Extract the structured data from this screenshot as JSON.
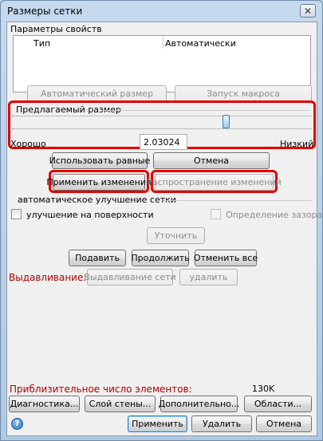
{
  "window": {
    "title": "Размеры сетки",
    "close_glyph": "✕"
  },
  "properties": {
    "group_label": "Параметры свойств",
    "columns": [
      "Тип",
      "Автоматически"
    ]
  },
  "buttons_row1": {
    "auto_size": "Автоматический размер",
    "run_macro": "Запуск макроса"
  },
  "suggested_size": {
    "label": "Предлагаемый размер",
    "left_label": "Хорошо",
    "right_label": "Низкий",
    "value": "2.03024",
    "slider_position": 0.72
  },
  "buttons_row2": {
    "use_equal": "Использовать равные",
    "cancel": "Отмена"
  },
  "buttons_row3": {
    "apply_changes": "Применить изменения",
    "propagate": "Распространение изменений"
  },
  "refinement": {
    "label": "автоматическое улучшение сетки",
    "surface": "улучшение на поверхности",
    "gap": "Определение зазора",
    "refine": "Уточнить"
  },
  "buttons_row4": {
    "suppress": "Подавить",
    "resume": "Продолжить",
    "undo_all": "Отменить все"
  },
  "extrusion": {
    "label": "Выдавливание:",
    "extrude_mesh": "Выдавливание сети",
    "delete": "удалить"
  },
  "element_count": {
    "label": "Приблизительное число элементов:",
    "value": "130K"
  },
  "bottom_row1": {
    "diagnostics": "Диагностика...",
    "wall_layer": "Слой стены...",
    "additional": "Дополнительно...",
    "regions": "Области..."
  },
  "bottom_row2": {
    "help_glyph": "?",
    "apply": "Применить",
    "delete": "Удалить",
    "cancel": "Отмена"
  }
}
